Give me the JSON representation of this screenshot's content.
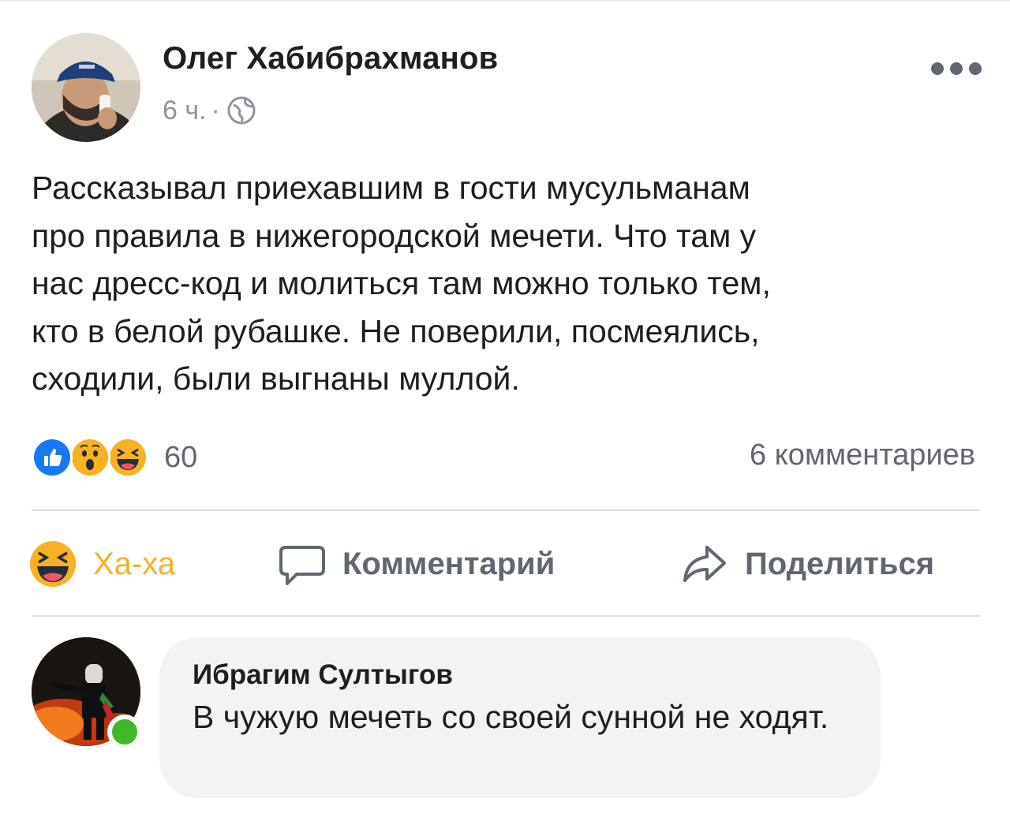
{
  "post": {
    "author": "Олег Хабибрахманов",
    "time": "6 ч.",
    "separator": "·",
    "text": "Рассказывал приехавшим в гости мусульманам\nпро правила в нижегородской мечети. Что там у\nнас дресс-код и молиться там можно только тем,\nкто в белой рубашке. Не поверили, посмеялись,\nсходили, были выгнаны муллой.",
    "privacy_icon": "globe-icon",
    "menu_icon": "more-dots-icon"
  },
  "reactions": {
    "icons": [
      "like-icon",
      "wow-icon",
      "haha-icon"
    ],
    "count": "60",
    "comments_count": "6 комментариев"
  },
  "actions": {
    "haha_label": "Ха-ха",
    "comment_label": "Комментарий",
    "share_label": "Поделиться"
  },
  "comment": {
    "author": "Ибрагим Султыгов",
    "text": "В чужую мечеть со своей сунной не ходят.",
    "online": true
  },
  "colors": {
    "like": "#1877f2",
    "haha": "#f7b125",
    "online": "#42b72a",
    "secondary_text": "#606770",
    "bubble": "#f2f3f5"
  }
}
